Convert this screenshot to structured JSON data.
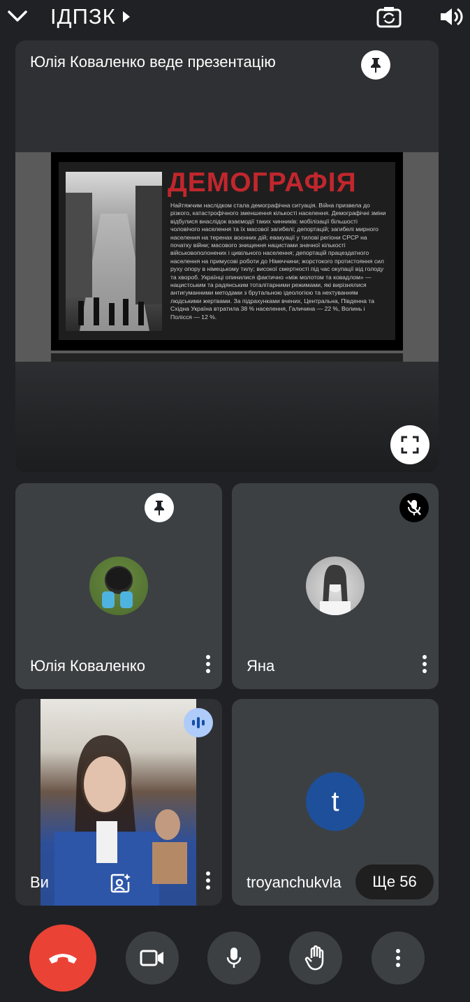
{
  "header": {
    "title": "ІДПЗК"
  },
  "presentation": {
    "label": "Юлія Коваленко веде презентацію",
    "slide_title": "ДЕМОГРАФІЯ",
    "slide_text": "Найтяжчим наслідком стала демографічна ситуація. Війна призвела до різкого, катастрофічного зменшення кількості населення. Демографічні зміни відбулися внаслідок взаємодії таких чинників: мобілізації більшості чоловічого населення та їх масової загибелі; депортацій; загибелі мирного населення на теренах воєнних дій; евакуації у тилові регіони СРСР на початку війни; масового знищення нацистами значної кількості військовополонених і цивільного населення; депортацій працездатного населення на примусові роботи до Німеччини; жорстокого протистояння сил руху опору в німецькому тилу; високої смертності під час окупації від голоду та хвороб. Українці опинилися фактично «між молотом та ковадлом» — нацистським та радянським тоталітарними режимами, які вирізнялися антигуманними методами з брутальною ідеологією та нехтуванням людськими жертвами. За підрахунками вчених, Центральна, Південна та Східна Україна втратила 38 % населення, Галичина — 22 %, Волинь і Полісся — 12 %."
  },
  "participants": [
    {
      "name": "Юлія Коваленко"
    },
    {
      "name": "Яна"
    },
    {
      "name": "Ви"
    },
    {
      "name": "troyanchukvla",
      "initial": "t",
      "avatar_color": "#1e4f9a"
    }
  ],
  "more_count": "Ще 56",
  "colors": {
    "background": "#202124",
    "tile": "#3c4043",
    "end_call": "#ea4335",
    "slide_title": "#c0272d",
    "speaking_badge": "#aecbfa"
  }
}
